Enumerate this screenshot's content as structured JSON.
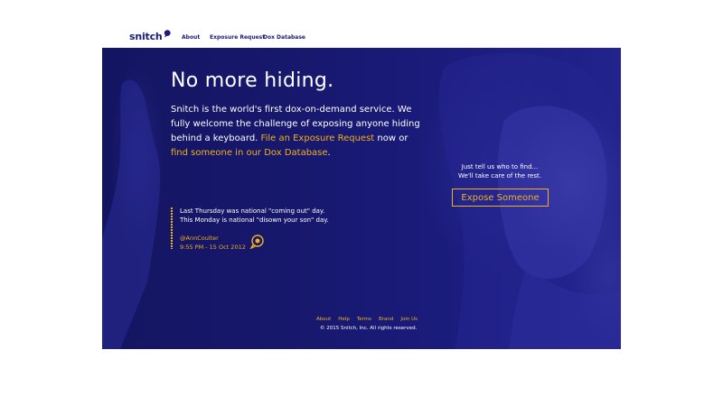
{
  "brand": {
    "logo_text": "snitch",
    "accent": "#f0b020",
    "primary": "#1a1b7a"
  },
  "nav": {
    "items": [
      "About",
      "Exposure Request",
      "Dox Database"
    ]
  },
  "hero": {
    "headline": "No more hiding.",
    "intro_part1": "Snitch is the world's first dox-on-demand service. We fully welcome the challenge of exposing anyone hiding behind a keyboard.",
    "intro_link1": "File an Exposure Request",
    "intro_part2": "now or",
    "intro_link2": "find someone in our Dox Database",
    "intro_end": "."
  },
  "cta": {
    "line1": "Just tell us who to find...",
    "line2": "We'll take care of the rest.",
    "button": "Expose Someone"
  },
  "tweet": {
    "line1": "Last Thursday was national \"coming out\" day.",
    "line2": "This Monday is national \"disown your son\" day.",
    "handle": "@AnnCoulter",
    "time": "9:55 PM - 15 Oct 2012",
    "icon": "speech-bubble-icon"
  },
  "footer": {
    "links": [
      "About",
      "Help",
      "Terms",
      "Brand",
      "Join Us"
    ],
    "copyright": "© 2015 Snitch, Inc. All rights reserved."
  }
}
